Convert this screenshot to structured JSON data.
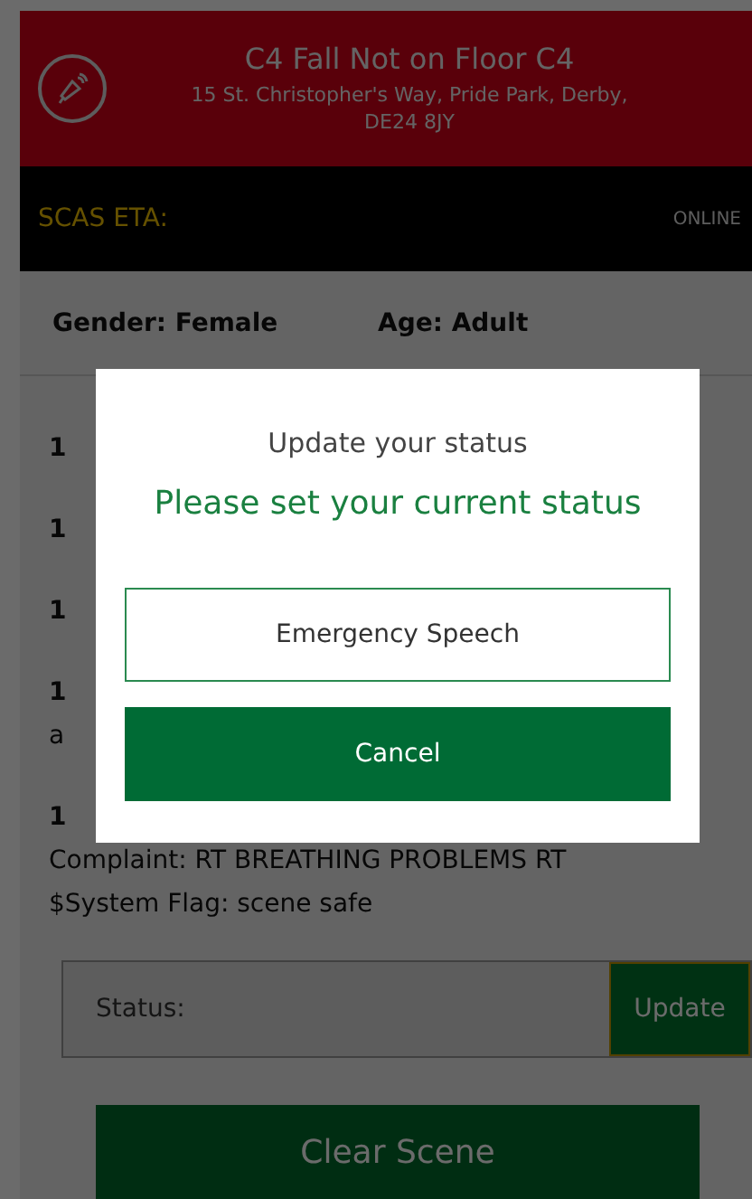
{
  "header": {
    "title": "C4 Fall Not on Floor C4",
    "address": "15 St. Christopher's Way, Pride Park, Derby, DE24 8JY"
  },
  "eta_bar": {
    "label": "SCAS ETA:",
    "connection": "ONLINE"
  },
  "patient": {
    "gender": "Gender: Female",
    "age": "Age: Adult"
  },
  "notes": [
    {
      "lines": [
        "1"
      ]
    },
    {
      "lines": [
        "1"
      ]
    },
    {
      "lines": [
        "1"
      ]
    },
    {
      "lines": [
        "1",
        "a"
      ]
    },
    {
      "lines": [
        "1",
        "Complaint: RT BREATHING PROBLEMS RT",
        "$System Flag: scene safe"
      ]
    }
  ],
  "status_field": {
    "placeholder": "Status:",
    "button": "Update"
  },
  "clear_button": "Clear Scene",
  "dialog": {
    "title": "Update your status",
    "message": "Please set your current status",
    "options": [
      {
        "label": "Emergency Speech",
        "kind": "outline"
      },
      {
        "label": "Cancel",
        "kind": "filled"
      }
    ]
  }
}
